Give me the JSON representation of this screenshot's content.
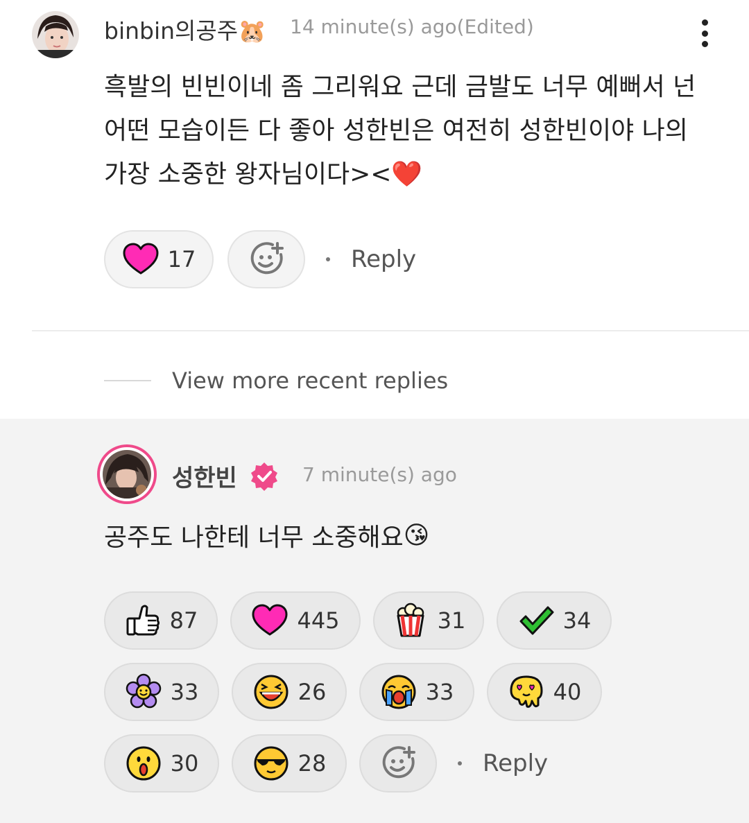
{
  "comment": {
    "username": "binbin의공주🐹",
    "time": "14 minute(s) ago(Edited)",
    "text": "흑발의 빈빈이네 좀 그리워요 근데 금발도 너무 예뻐서 넌 어떤 모습이든 다 좋아 성한빈은 여전히 성한빈이야 나의 가장 소중한 왕자님이다><❤️",
    "like_count": "17",
    "reply_label": "Reply"
  },
  "view_more_label": "View more recent replies",
  "reply": {
    "username": "성한빈",
    "time": "7 minute(s) ago",
    "text": "공주도 나한테 너무 소중해요",
    "text_emoji": "😘",
    "reactions": [
      {
        "icon": "thumbs-up-icon",
        "count": "87"
      },
      {
        "icon": "heart-icon",
        "count": "445"
      },
      {
        "icon": "popcorn-icon",
        "count": "31"
      },
      {
        "icon": "checkmark-icon",
        "count": "34"
      },
      {
        "icon": "flower-icon",
        "count": "33"
      },
      {
        "icon": "laughing-face-icon",
        "count": "26"
      },
      {
        "icon": "crying-face-icon",
        "count": "33"
      },
      {
        "icon": "heart-eyes-melting-icon",
        "count": "40"
      },
      {
        "icon": "surprised-face-icon",
        "count": "30"
      },
      {
        "icon": "sunglasses-face-icon",
        "count": "28"
      }
    ],
    "reply_label": "Reply"
  },
  "colors": {
    "accent_pink": "#ef4a8a",
    "heart_magenta": "#ff2bb5",
    "pill_bg": "#f4f4f4",
    "reply_bg": "#f3f3f3"
  }
}
